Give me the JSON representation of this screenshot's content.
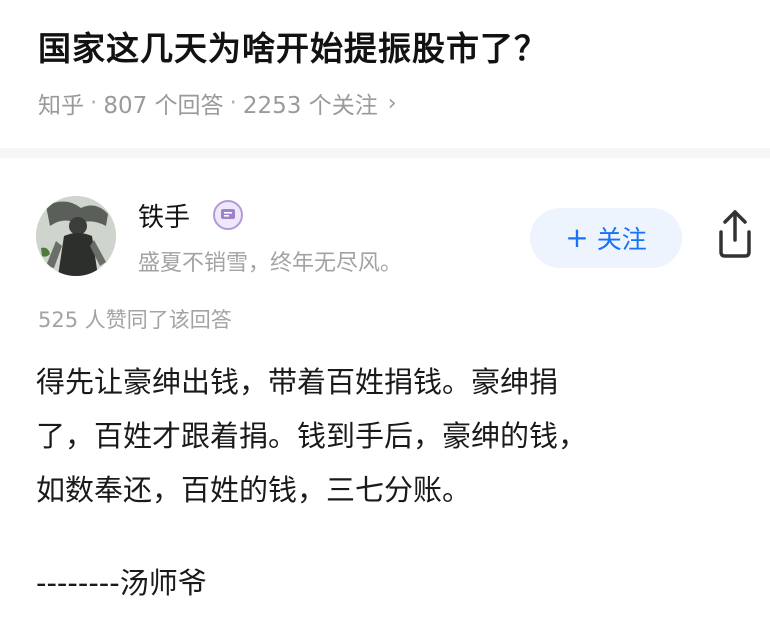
{
  "question": {
    "title": "国家这几天为啥开始提振股市了？",
    "source": "知乎",
    "answers": "807 个回答",
    "followers": "2253 个关注",
    "separator": "·",
    "chevron": "›"
  },
  "author": {
    "name": "铁手",
    "bio": "盛夏不销雪，终年无尽风。",
    "badge_icon": "verified-badge-icon",
    "avatar_icon": "avatar-image"
  },
  "actions": {
    "follow_plus": "+",
    "follow_label": "关注",
    "share_icon": "share-icon"
  },
  "answer": {
    "likes": "525 人赞同了该回答",
    "lines": [
      "得先让豪绅出钱，带着百姓捐钱。豪绅捐",
      "了，百姓才跟着捐。钱到手后，豪绅的钱，",
      "如数奉还，百姓的钱，三七分账。"
    ],
    "signature": "--------汤师爷"
  },
  "colors": {
    "accent": "#1772f6",
    "follow_bg": "#eef4fd",
    "meta_gray": "#9a9a9a",
    "badge_purple": "#b39ad6"
  }
}
